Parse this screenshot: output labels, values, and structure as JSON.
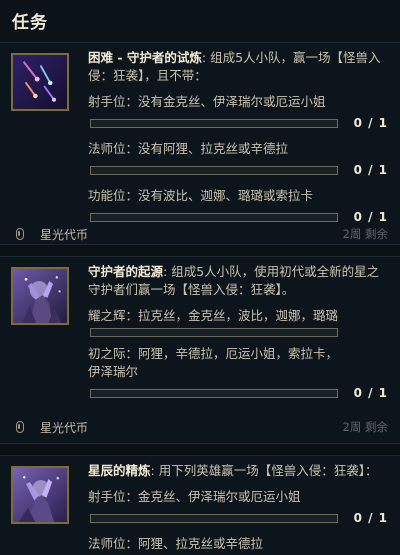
{
  "header": {
    "title": "任务"
  },
  "missions": [
    {
      "thumb_icon": "meteor-shower-icon",
      "title": "困难 - 守护者的试炼",
      "description": ": 组成5人小队，赢一场【怪兽入侵：狂袭】，且不带：",
      "objectives": [
        {
          "label": "射手位：没有金克丝、伊泽瑞尔或厄运小姐",
          "count": "0 / 1",
          "progress": 0
        },
        {
          "label": "法师位：没有阿狸、拉克丝或辛德拉",
          "count": "0 / 1",
          "progress": 0
        },
        {
          "label": "功能位：没有波比、迦娜、璐璐或索拉卡",
          "count": "0 / 1",
          "progress": 0
        }
      ],
      "reward": "星光代币",
      "time_left": "2周 剩余"
    },
    {
      "thumb_icon": "star-guardian-art-icon",
      "title": "守护者的起源",
      "description": ": 组成5人小队，使用初代或全新的星之守护者们赢一场【怪兽入侵：狂袭】。",
      "objectives": [
        {
          "label": "耀之辉：拉克丝，金克丝，波比，迦娜，璐璐",
          "count": "",
          "progress": 0
        },
        {
          "label": "初之际：阿狸，辛德拉，厄运小姐，索拉卡，伊泽瑞尔",
          "count": "0 / 1",
          "progress": 0
        }
      ],
      "reward": "星光代币",
      "time_left": "2周 剩余"
    },
    {
      "thumb_icon": "star-guardian-art-icon",
      "title": "星辰的精炼",
      "description": ": 用下列英雄赢一场【怪兽入侵：狂袭】：",
      "objectives": [
        {
          "label": "射手位：金克丝、伊泽瑞尔或厄运小姐",
          "count": "0 / 1",
          "progress": 0
        },
        {
          "label": "法师位：阿狸、拉克丝或辛德拉",
          "count": "",
          "progress": 0
        }
      ]
    }
  ],
  "colors": {
    "background": "#0a1016",
    "panel": "#0d151c",
    "gold_frame": "#7e6b3a",
    "bar_border": "#6f6a5d",
    "text": "#c8c1ad",
    "title_text": "#f1e9d4"
  }
}
